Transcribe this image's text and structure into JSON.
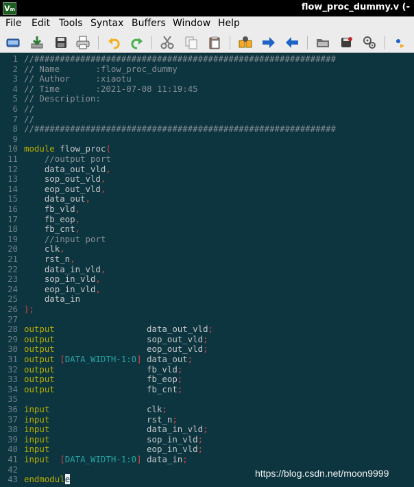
{
  "window": {
    "title": "flow_proc_dummy.v (-",
    "app_icon_text": "Vim"
  },
  "menu": [
    "File",
    "Edit",
    "Tools",
    "Syntax",
    "Buffers",
    "Window",
    "Help"
  ],
  "toolbar_icons": [
    "open-file-icon",
    "download-save-icon",
    "save-icon",
    "print-icon",
    "undo-icon",
    "redo-icon",
    "cut-icon",
    "copy-icon",
    "paste-icon",
    "find-replace-icon",
    "forward-arrow-icon",
    "back-arrow-icon",
    "load-session-icon",
    "save-session-icon",
    "run-script-icon",
    "tag-jump-icon"
  ],
  "colors": {
    "background": "#0c3540",
    "comment": "#8a8f94",
    "keyword": "#b9ad00",
    "punct": "#e0433f",
    "const": "#2aa4a0",
    "text": "#c7c7c7",
    "line_number": "#6e7f86"
  },
  "lines": [
    {
      "n": "1",
      "tokens": [
        {
          "t": "//###########################################################",
          "c": "comment"
        }
      ]
    },
    {
      "n": "2",
      "tokens": [
        {
          "t": "// Name       :flow_proc_dummy",
          "c": "comment"
        }
      ]
    },
    {
      "n": "3",
      "tokens": [
        {
          "t": "// Author     :xiaotu",
          "c": "comment"
        }
      ]
    },
    {
      "n": "4",
      "tokens": [
        {
          "t": "// Time       :2021-07-08 11:19:45",
          "c": "comment"
        }
      ]
    },
    {
      "n": "5",
      "tokens": [
        {
          "t": "// Description:",
          "c": "comment"
        }
      ]
    },
    {
      "n": "6",
      "tokens": [
        {
          "t": "//",
          "c": "comment"
        }
      ]
    },
    {
      "n": "7",
      "tokens": [
        {
          "t": "//",
          "c": "comment"
        }
      ]
    },
    {
      "n": "8",
      "tokens": [
        {
          "t": "//###########################################################",
          "c": "comment"
        }
      ]
    },
    {
      "n": "9",
      "tokens": []
    },
    {
      "n": "10",
      "tokens": [
        {
          "t": "module",
          "c": "keyword"
        },
        {
          "t": " flow_proc",
          "c": "ident"
        },
        {
          "t": "(",
          "c": "punct"
        }
      ]
    },
    {
      "n": "11",
      "tokens": [
        {
          "t": "    //output port",
          "c": "comment"
        }
      ]
    },
    {
      "n": "12",
      "tokens": [
        {
          "t": "    data_out_vld",
          "c": "ident"
        },
        {
          "t": ",",
          "c": "punct"
        }
      ]
    },
    {
      "n": "13",
      "tokens": [
        {
          "t": "    sop_out_vld",
          "c": "ident"
        },
        {
          "t": ",",
          "c": "punct"
        }
      ]
    },
    {
      "n": "14",
      "tokens": [
        {
          "t": "    eop_out_vld",
          "c": "ident"
        },
        {
          "t": ",",
          "c": "punct"
        }
      ]
    },
    {
      "n": "15",
      "tokens": [
        {
          "t": "    data_out",
          "c": "ident"
        },
        {
          "t": ",",
          "c": "punct"
        }
      ]
    },
    {
      "n": "16",
      "tokens": [
        {
          "t": "    fb_vld",
          "c": "ident"
        },
        {
          "t": ",",
          "c": "punct"
        }
      ]
    },
    {
      "n": "17",
      "tokens": [
        {
          "t": "    fb_eop",
          "c": "ident"
        },
        {
          "t": ",",
          "c": "punct"
        }
      ]
    },
    {
      "n": "18",
      "tokens": [
        {
          "t": "    fb_cnt",
          "c": "ident"
        },
        {
          "t": ",",
          "c": "punct"
        }
      ]
    },
    {
      "n": "19",
      "tokens": [
        {
          "t": "    //input port",
          "c": "comment"
        }
      ]
    },
    {
      "n": "20",
      "tokens": [
        {
          "t": "    clk",
          "c": "ident"
        },
        {
          "t": ",",
          "c": "punct"
        }
      ]
    },
    {
      "n": "21",
      "tokens": [
        {
          "t": "    rst_n",
          "c": "ident"
        },
        {
          "t": ",",
          "c": "punct"
        }
      ]
    },
    {
      "n": "22",
      "tokens": [
        {
          "t": "    data_in_vld",
          "c": "ident"
        },
        {
          "t": ",",
          "c": "punct"
        }
      ]
    },
    {
      "n": "23",
      "tokens": [
        {
          "t": "    sop_in_vld",
          "c": "ident"
        },
        {
          "t": ",",
          "c": "punct"
        }
      ]
    },
    {
      "n": "24",
      "tokens": [
        {
          "t": "    eop_in_vld",
          "c": "ident"
        },
        {
          "t": ",",
          "c": "punct"
        }
      ]
    },
    {
      "n": "25",
      "tokens": [
        {
          "t": "    data_in",
          "c": "ident"
        }
      ]
    },
    {
      "n": "26",
      "tokens": [
        {
          "t": ");",
          "c": "punct"
        }
      ]
    },
    {
      "n": "27",
      "tokens": []
    },
    {
      "n": "28",
      "tokens": [
        {
          "t": "output",
          "c": "keyword"
        },
        {
          "t": "                  data_out_vld",
          "c": "ident"
        },
        {
          "t": ";",
          "c": "punct"
        }
      ]
    },
    {
      "n": "29",
      "tokens": [
        {
          "t": "output",
          "c": "keyword"
        },
        {
          "t": "                  sop_out_vld",
          "c": "ident"
        },
        {
          "t": ";",
          "c": "punct"
        }
      ]
    },
    {
      "n": "30",
      "tokens": [
        {
          "t": "output",
          "c": "keyword"
        },
        {
          "t": "                  eop_out_vld",
          "c": "ident"
        },
        {
          "t": ";",
          "c": "punct"
        }
      ]
    },
    {
      "n": "31",
      "tokens": [
        {
          "t": "output",
          "c": "keyword"
        },
        {
          "t": " ",
          "c": "ident"
        },
        {
          "t": "[",
          "c": "punct"
        },
        {
          "t": "DATA_WIDTH-1:0",
          "c": "const"
        },
        {
          "t": "]",
          "c": "punct"
        },
        {
          "t": " data_out",
          "c": "ident"
        },
        {
          "t": ";",
          "c": "punct"
        }
      ]
    },
    {
      "n": "32",
      "tokens": [
        {
          "t": "output",
          "c": "keyword"
        },
        {
          "t": "                  fb_vld",
          "c": "ident"
        },
        {
          "t": ";",
          "c": "punct"
        }
      ]
    },
    {
      "n": "33",
      "tokens": [
        {
          "t": "output",
          "c": "keyword"
        },
        {
          "t": "                  fb_eop",
          "c": "ident"
        },
        {
          "t": ";",
          "c": "punct"
        }
      ]
    },
    {
      "n": "34",
      "tokens": [
        {
          "t": "output",
          "c": "keyword"
        },
        {
          "t": "                  fb_cnt",
          "c": "ident"
        },
        {
          "t": ";",
          "c": "punct"
        }
      ]
    },
    {
      "n": "35",
      "tokens": []
    },
    {
      "n": "36",
      "tokens": [
        {
          "t": "input",
          "c": "keyword"
        },
        {
          "t": "                   clk",
          "c": "ident"
        },
        {
          "t": ";",
          "c": "punct"
        }
      ]
    },
    {
      "n": "37",
      "tokens": [
        {
          "t": "input",
          "c": "keyword"
        },
        {
          "t": "                   rst_n",
          "c": "ident"
        },
        {
          "t": ";",
          "c": "punct"
        }
      ]
    },
    {
      "n": "38",
      "tokens": [
        {
          "t": "input",
          "c": "keyword"
        },
        {
          "t": "                   data_in_vld",
          "c": "ident"
        },
        {
          "t": ";",
          "c": "punct"
        }
      ]
    },
    {
      "n": "39",
      "tokens": [
        {
          "t": "input",
          "c": "keyword"
        },
        {
          "t": "                   sop_in_vld",
          "c": "ident"
        },
        {
          "t": ";",
          "c": "punct"
        }
      ]
    },
    {
      "n": "40",
      "tokens": [
        {
          "t": "input",
          "c": "keyword"
        },
        {
          "t": "                   eop_in_vld",
          "c": "ident"
        },
        {
          "t": ";",
          "c": "punct"
        }
      ]
    },
    {
      "n": "41",
      "tokens": [
        {
          "t": "input",
          "c": "keyword"
        },
        {
          "t": "  ",
          "c": "ident"
        },
        {
          "t": "[",
          "c": "punct"
        },
        {
          "t": "DATA_WIDTH-1:0",
          "c": "const"
        },
        {
          "t": "]",
          "c": "punct"
        },
        {
          "t": " data_in",
          "c": "ident"
        },
        {
          "t": ";",
          "c": "punct"
        }
      ]
    },
    {
      "n": "42",
      "tokens": []
    },
    {
      "n": "43",
      "tokens": [
        {
          "t": "endmodul",
          "c": "keyword"
        },
        {
          "t": "e",
          "c": "cursor"
        }
      ]
    }
  ],
  "watermark": "https://blog.csdn.net/moon9999"
}
